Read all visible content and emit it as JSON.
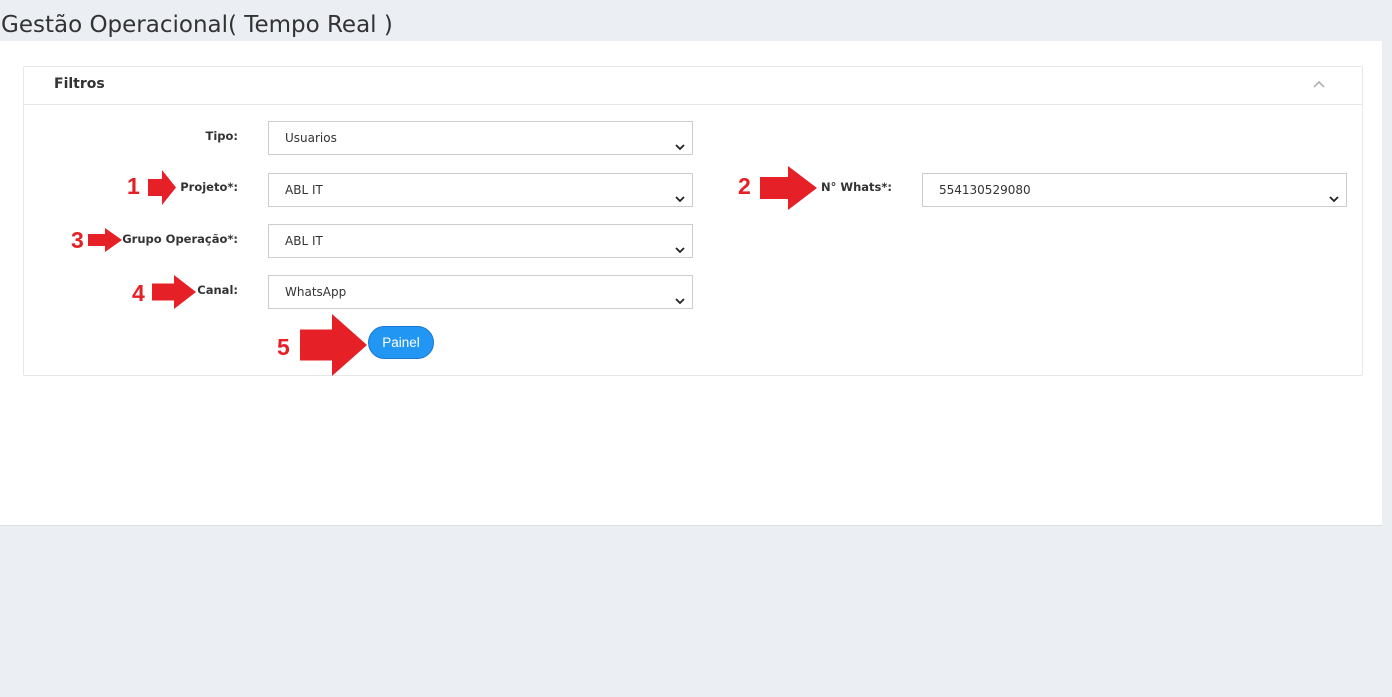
{
  "page": {
    "title": "Gestão Operacional( Tempo Real )"
  },
  "panel": {
    "title": "Filtros",
    "collapse_icon": "chevron-up-icon"
  },
  "filters": {
    "tipo": {
      "label": "Tipo:",
      "value": "Usuarios"
    },
    "projeto": {
      "label": "Projeto*:",
      "value": "ABL IT"
    },
    "grupo": {
      "label": "Grupo Operação*:",
      "value": "ABL IT"
    },
    "canal": {
      "label": "Canal:",
      "value": "WhatsApp"
    },
    "whats": {
      "label": "N° Whats*:",
      "value": "554130529080"
    }
  },
  "actions": {
    "painel_label": "Painel"
  },
  "annotations": {
    "n1": "1",
    "n2": "2",
    "n3": "3",
    "n4": "4",
    "n5": "5",
    "color": "#e52026"
  },
  "colors": {
    "accent": "#2196f3",
    "background": "#ebeef3"
  }
}
